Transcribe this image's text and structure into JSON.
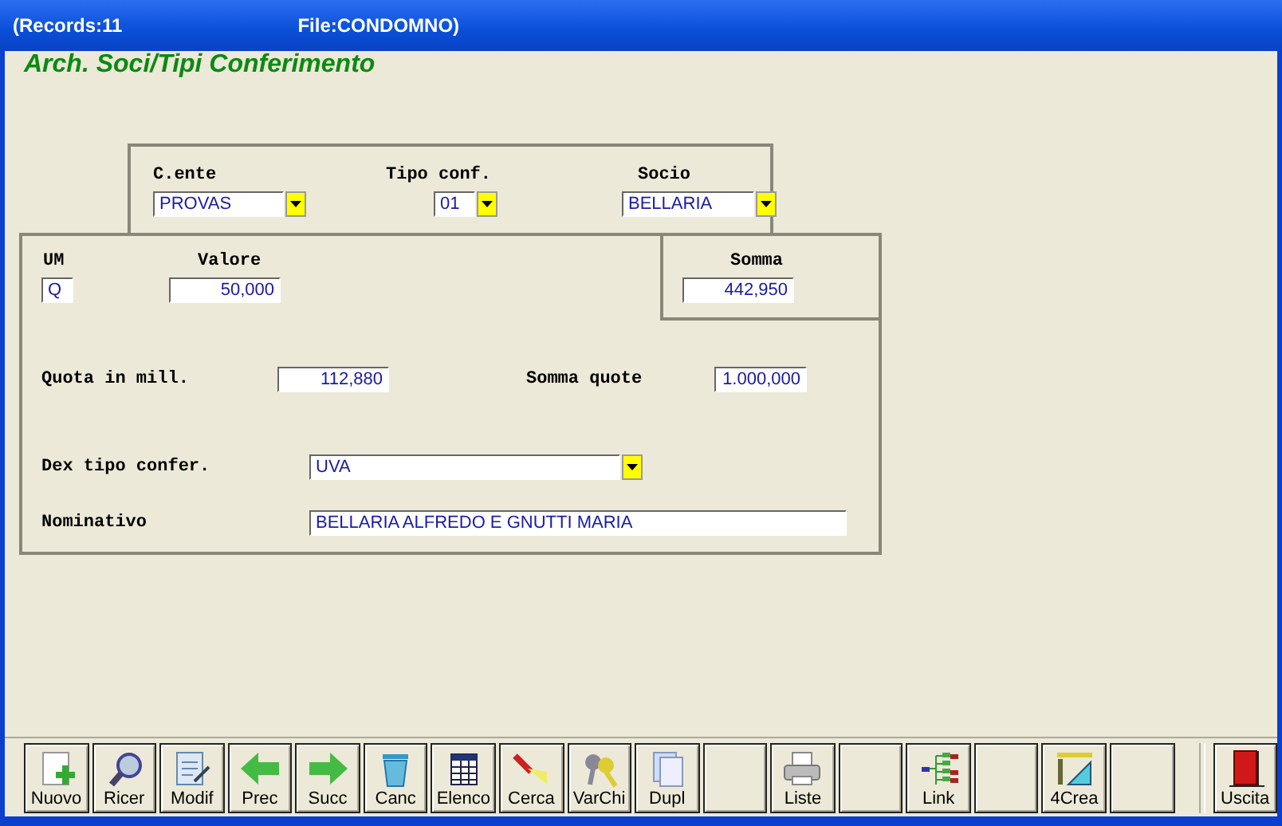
{
  "window": {
    "records": "(Records:11",
    "file": "File:CONDOMNO)"
  },
  "form_title": "Arch. Soci/Tipi Conferimento",
  "header_fields": [
    {
      "label": "C.ente",
      "value": "PROVAS",
      "kind": "combo"
    },
    {
      "label": "Tipo conf.",
      "value": "01",
      "kind": "combo"
    },
    {
      "label": "Socio",
      "value": "BELLARIA",
      "kind": "combo"
    }
  ],
  "detail_fields": [
    {
      "label": "UM",
      "value": "Q",
      "kind": "text"
    },
    {
      "label": "Valore",
      "value": "50,000",
      "kind": "number"
    },
    {
      "label": "Somma",
      "value": "442,950",
      "kind": "number"
    },
    {
      "label": "Quota in mill.",
      "value": "112,880",
      "kind": "number"
    },
    {
      "label": "Somma quote",
      "value": "1.000,000",
      "kind": "number"
    },
    {
      "label": "Dex tipo confer.",
      "value": "UVA",
      "kind": "combo"
    },
    {
      "label": "Nominativo",
      "value": "BELLARIA ALFREDO E GNUTTI MARIA",
      "kind": "text"
    }
  ],
  "toolbar": [
    {
      "kind": "command",
      "label": "Nuovo"
    },
    {
      "kind": "command",
      "label": "Ricer"
    },
    {
      "kind": "command",
      "label": "Modif"
    },
    {
      "kind": "command",
      "label": "Prec"
    },
    {
      "kind": "command",
      "label": "Succ"
    },
    {
      "kind": "command",
      "label": "Canc"
    },
    {
      "kind": "command",
      "label": "Elenco"
    },
    {
      "kind": "command",
      "label": "Cerca"
    },
    {
      "kind": "command",
      "label": "VarChi"
    },
    {
      "kind": "command",
      "label": "Dupl"
    },
    {
      "kind": "blank"
    },
    {
      "kind": "command",
      "label": "Liste"
    },
    {
      "kind": "blank"
    },
    {
      "kind": "command",
      "label": "Link"
    },
    {
      "kind": "blank"
    },
    {
      "kind": "command",
      "label": "4Crea"
    },
    {
      "kind": "blank"
    }
  ],
  "exit_button": {
    "label": "Uscita"
  }
}
